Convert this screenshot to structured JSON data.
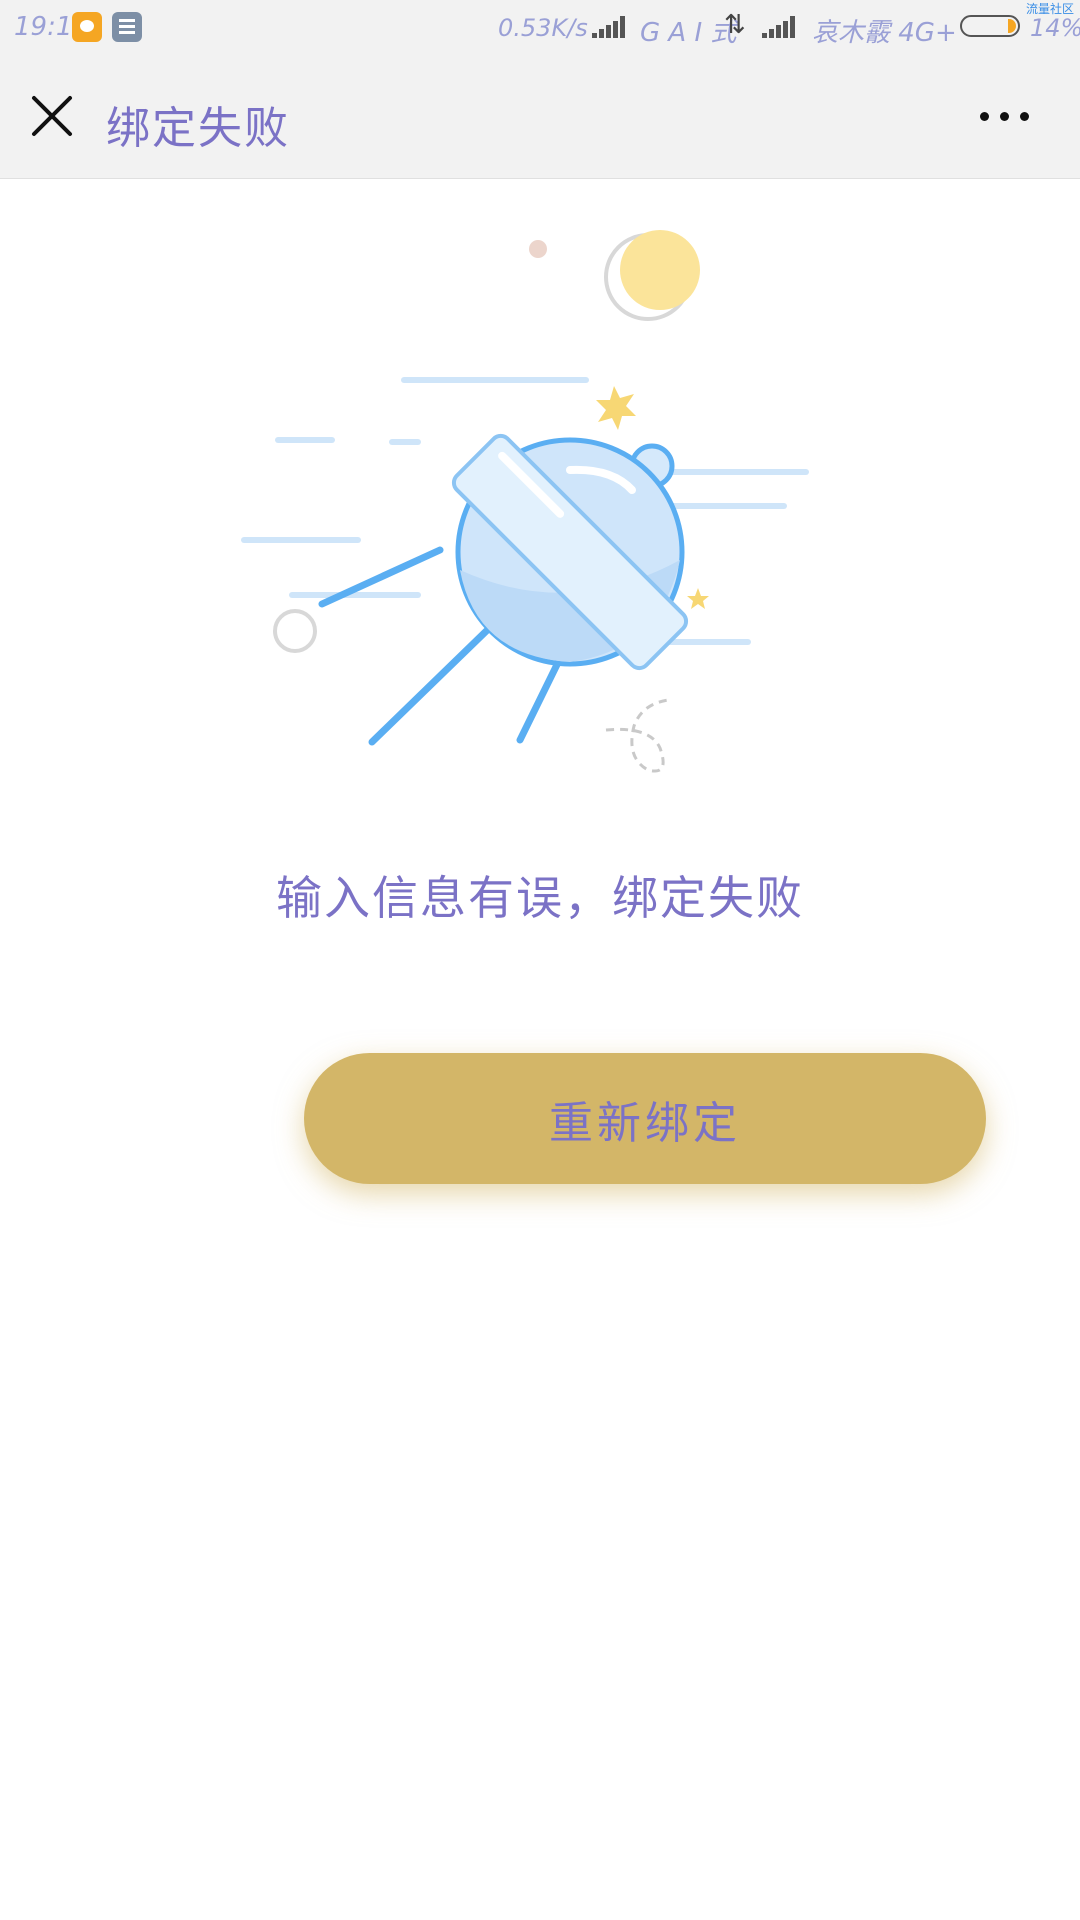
{
  "status_bar": {
    "time": "19:17",
    "network_speed": "0.53K/s",
    "carrier_1": "G A I 式",
    "carrier_2": "哀木霰 4G+",
    "battery_percent": "14%",
    "corner_tag": "流量社区",
    "icons": [
      "chat-notification-icon",
      "calendar-notification-icon",
      "signal-icon",
      "data-arrows-icon",
      "battery-icon"
    ]
  },
  "nav": {
    "title": "绑定失败",
    "close_icon": "close-icon",
    "more_icon": "more-icon"
  },
  "main": {
    "illustration": "satellite-illustration",
    "message": "输入信息有误，绑定失败",
    "button_label": "重新绑定"
  },
  "colors": {
    "button_bg": "#d3b668",
    "text_accent": "#7b72c6",
    "satellite_blue": "#64b5f6",
    "moon_yellow": "#fbe49a"
  }
}
